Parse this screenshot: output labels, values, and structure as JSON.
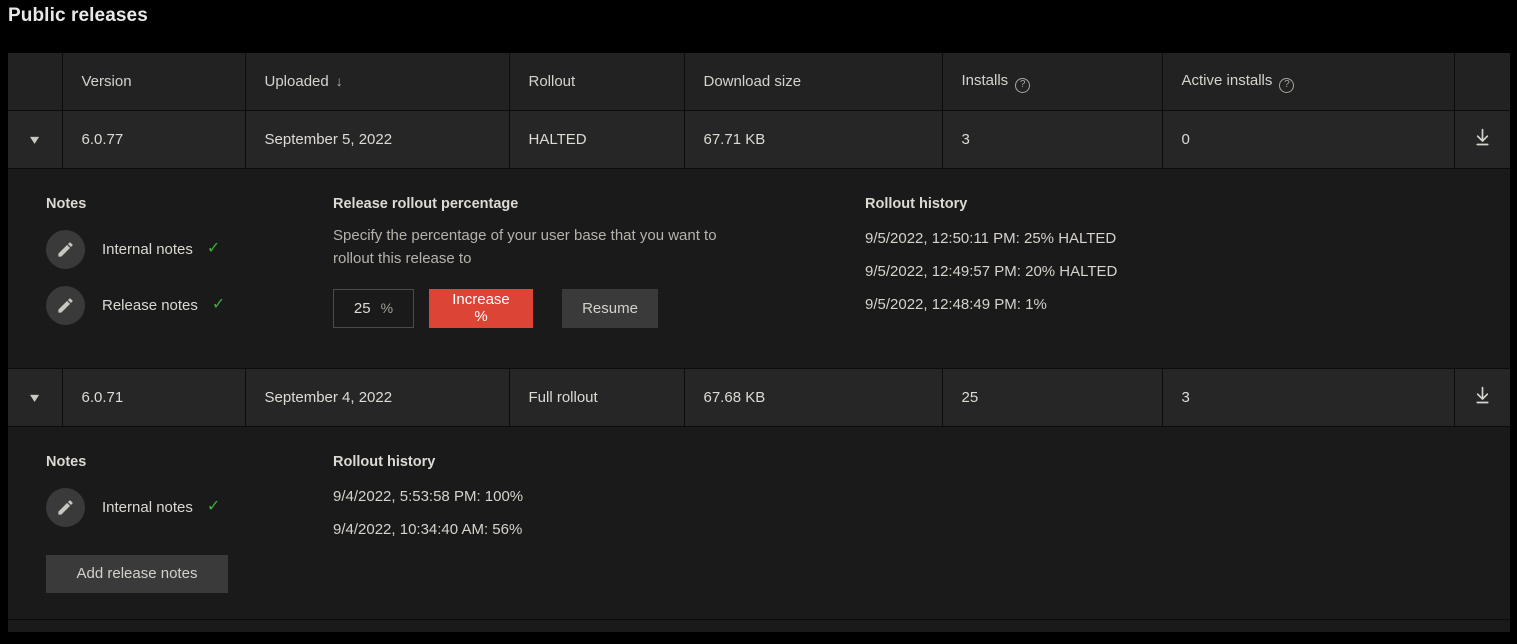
{
  "page": {
    "title": "Public releases",
    "background_color": "#000000",
    "accent_color": "#dc4436",
    "check_color": "#3fae3f"
  },
  "table": {
    "columns": [
      {
        "key": "toggle",
        "label": ""
      },
      {
        "key": "version",
        "label": "Version"
      },
      {
        "key": "uploaded",
        "label": "Uploaded",
        "sort_icon": "arrow-down",
        "sorted": true
      },
      {
        "key": "rollout",
        "label": "Rollout"
      },
      {
        "key": "size",
        "label": "Download size"
      },
      {
        "key": "installs",
        "label": "Installs",
        "help_icon": "question-circle-icon"
      },
      {
        "key": "active",
        "label": "Active installs",
        "help_icon": "question-circle-icon"
      },
      {
        "key": "download",
        "label": ""
      }
    ],
    "rows": [
      {
        "toggle_icon": "chevron-down-icon",
        "version": "6.0.77",
        "uploaded": "September 5, 2022",
        "rollout": "HALTED",
        "size": "67.71 KB",
        "installs": "3",
        "active_installs": "0",
        "download_icon": "download-icon",
        "detail": {
          "notes": {
            "heading": "Notes",
            "items": [
              {
                "icon": "pencil-icon",
                "label": "Internal notes",
                "status_icon": "check-icon"
              },
              {
                "icon": "pencil-icon",
                "label": "Release notes",
                "status_icon": "check-icon"
              }
            ],
            "add_button": null
          },
          "rollout_percentage": {
            "heading": "Release rollout percentage",
            "description": "Specify the percentage of your user base that you want to rollout this release to",
            "input_value": "25",
            "input_suffix": "%",
            "increase_label": "Increase %",
            "resume_label": "Resume"
          },
          "history": {
            "heading": "Rollout history",
            "entries": [
              "9/5/2022, 12:50:11 PM: 25% HALTED",
              "9/5/2022, 12:49:57 PM: 20% HALTED",
              "9/5/2022, 12:48:49 PM: 1%"
            ]
          }
        }
      },
      {
        "toggle_icon": "chevron-down-icon",
        "version": "6.0.71",
        "uploaded": "September 4, 2022",
        "rollout": "Full rollout",
        "size": "67.68 KB",
        "installs": "25",
        "active_installs": "3",
        "download_icon": "download-icon",
        "detail": {
          "notes": {
            "heading": "Notes",
            "items": [
              {
                "icon": "pencil-icon",
                "label": "Internal notes",
                "status_icon": "check-icon"
              }
            ],
            "add_button": "Add release notes"
          },
          "rollout_percentage": null,
          "history": {
            "heading": "Rollout history",
            "entries": [
              "9/4/2022, 5:53:58 PM: 100%",
              "9/4/2022, 10:34:40 AM: 56%"
            ]
          }
        }
      }
    ]
  }
}
